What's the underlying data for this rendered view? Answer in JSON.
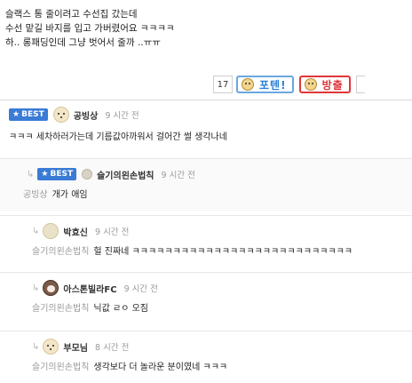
{
  "post": {
    "lines": [
      "슬랙스 통 줄이려고 수선집 갔는데",
      "수선 맡길 바지를 입고 가버렸어요 ㅋㅋㅋㅋ",
      "하.. 롱패딩인데 그냥 벗어서 줄까 ..ㅠㅠ"
    ]
  },
  "reactions": {
    "count": "17",
    "up_label": "포텐!",
    "down_label": "방출"
  },
  "comments": [
    {
      "badge": "BEST",
      "nick": "공빙상",
      "time": "9 시간 전",
      "text": "ㅋㅋㅋ 세차하러가는데 기름값아까워서 걸어간 썰 생각나네"
    },
    {
      "badge": "BEST",
      "nick": "슬기의왼손법칙",
      "time": "9 시간 전",
      "mention": "공빙상",
      "text": "개가 애임"
    },
    {
      "nick": "박효신",
      "time": "9 시간 전",
      "mention": "슬기의왼손법칙",
      "text": "헐 진짜네 ㅋㅋㅋㅋㅋㅋㅋㅋㅋㅋㅋㅋㅋㅋㅋㅋㅋㅋㅋㅋㅋㅋㅋㅋㅋㅋㅋ"
    },
    {
      "nick": "아스톤빌라FC",
      "time": "9 시간 전",
      "mention": "슬기의왼손법칙",
      "text": "닉값 ㄹㅇ 오짐"
    },
    {
      "nick": "부모님",
      "time": "8 시간 전",
      "mention": "슬기의왼손법칙",
      "text": "생각보다 더 놀라운 분이였네 ㅋㅋㅋ"
    }
  ],
  "icons": {
    "reply_arrow": "↳",
    "star": "★"
  }
}
